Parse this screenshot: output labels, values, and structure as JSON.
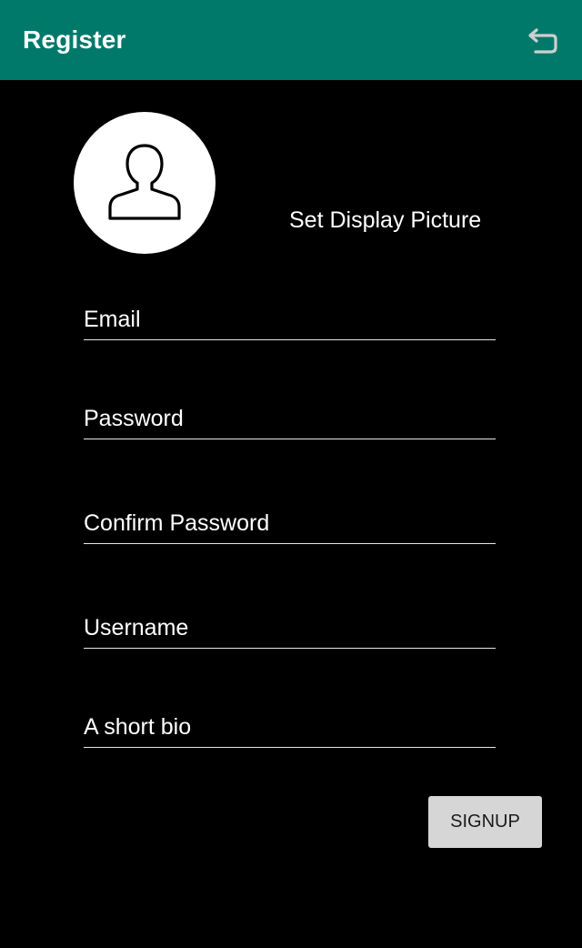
{
  "appbar": {
    "title": "Register",
    "back_icon": "undo-back-icon",
    "color": "#00796b"
  },
  "profile": {
    "avatar_icon": "person-icon",
    "set_picture_label": "Set Display Picture"
  },
  "form": {
    "email": {
      "placeholder": "Email",
      "value": ""
    },
    "password": {
      "placeholder": "Password",
      "value": ""
    },
    "confirm_password": {
      "placeholder": "Confirm Password",
      "value": ""
    },
    "username": {
      "placeholder": "Username",
      "value": ""
    },
    "bio": {
      "placeholder": "A short bio",
      "value": ""
    }
  },
  "actions": {
    "signup_label": "SIGNUP"
  }
}
